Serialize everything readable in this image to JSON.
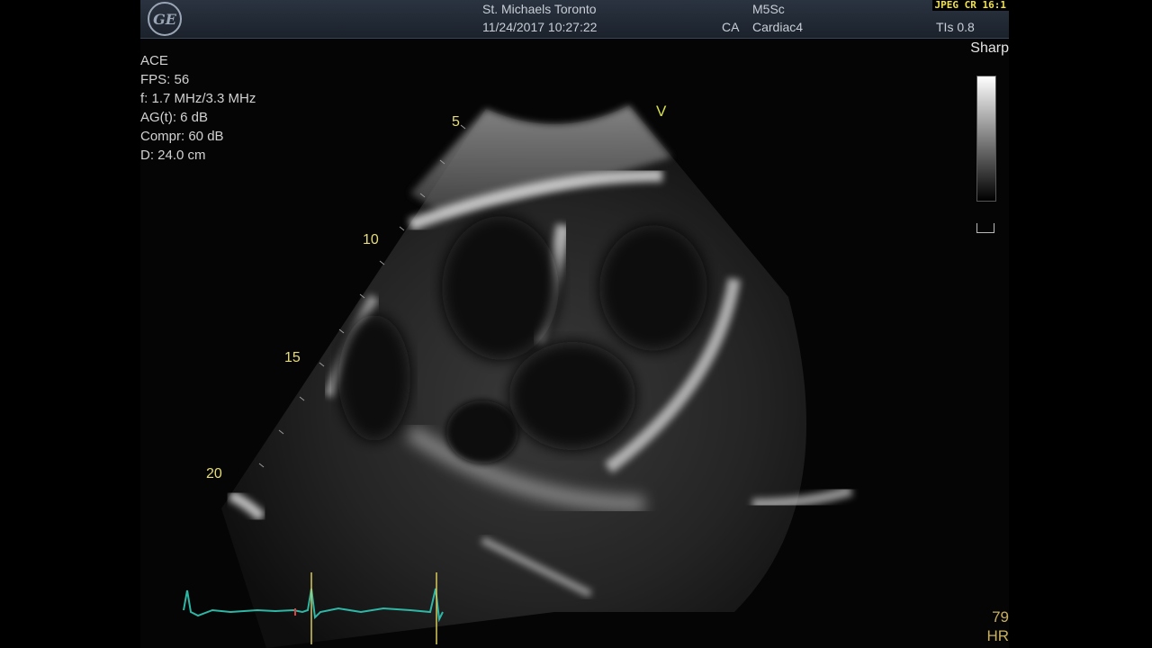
{
  "header": {
    "facility": "St. Michaels Toronto",
    "datetime": "11/24/2017 10:27:22",
    "probe": "M5Sc",
    "region": "CA",
    "preset": "Cardiac4",
    "tis": "TIs 0.8",
    "compression": "JPEG CR 16:1"
  },
  "params": {
    "mode": "ACE",
    "fps": "FPS: 56",
    "freq": "f: 1.7 MHz/3.3 MHz",
    "gain": "AG(t):  6 dB",
    "compr": "Compr: 60 dB",
    "depth": "D: 24.0 cm"
  },
  "sharp_label": "Sharp",
  "depth_marks": [
    "5",
    "10",
    "15",
    "20"
  ],
  "v_marker": "V",
  "hr": {
    "value": "79",
    "label": "HR"
  },
  "colors": {
    "ecg": "#2fb7a6",
    "depth": "#e6dc7a",
    "marker": "#d8e04a",
    "hr": "#c8b060"
  },
  "icons": {
    "logo": "ge-logo-icon"
  }
}
